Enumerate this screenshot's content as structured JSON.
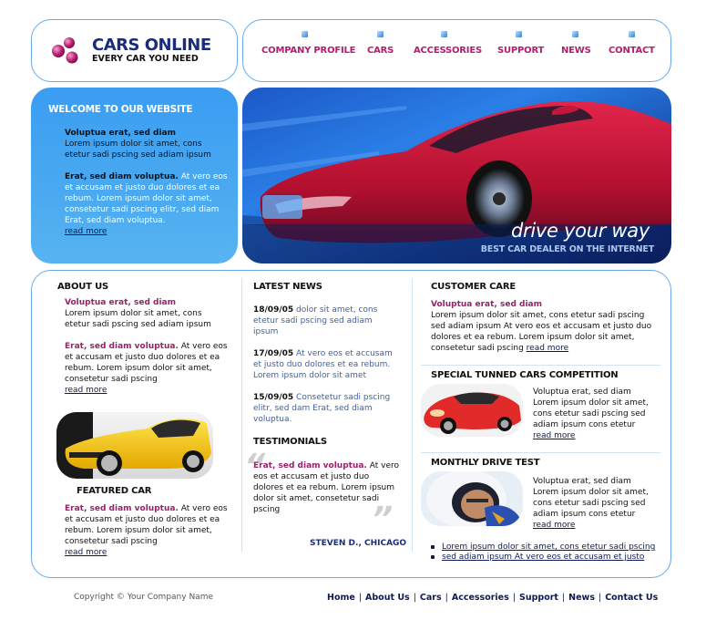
{
  "brand": {
    "title": "CARS ONLINE",
    "subtitle": "EVERY CAR YOU NEED"
  },
  "nav": {
    "items": [
      {
        "label": "COMPANY PROFILE"
      },
      {
        "label": "CARS"
      },
      {
        "label": "ACCESSORIES"
      },
      {
        "label": "SUPPORT"
      },
      {
        "label": "NEWS"
      },
      {
        "label": "CONTACT"
      }
    ]
  },
  "welcome": {
    "title": "WELCOME TO OUR WEBSITE",
    "p1_bold": "Voluptua erat, sed diam",
    "p1_text": "Lorem ipsum dolor sit amet, cons etetur sadi pscing sed adiam ipsum",
    "p2_bold": "Erat, sed diam voluptua.",
    "p2_white": "At vero eos et accusam et justo duo dolores et ea rebum. Lorem ipsum dolor sit amet, consetetur sadi pscing elitr, sed diam Erat, sed diam voluptua.",
    "read_more": "read more"
  },
  "hero": {
    "tagline": "drive your way",
    "subtag": "BEST CAR DEALER ON THE INTERNET"
  },
  "about": {
    "heading": "ABOUT US",
    "p1_title": "Voluptua erat, sed diam",
    "p1_text": "Lorem ipsum dolor sit amet, cons etetur sadi pscing sed adiam ipsum",
    "p2_title": "Erat, sed diam voluptua.",
    "p2_text": "At vero eos et accusam et justo duo dolores et ea rebum. Lorem ipsum dolor sit amet, consetetur sadi pscing",
    "read_more": "read more",
    "featured_heading": "FEATURED CAR",
    "f_title": "Erat, sed diam voluptua.",
    "f_text": "At vero eos et accusam et justo duo dolores et ea rebum. Lorem ipsum dolor sit amet, consetetur sadi pscing",
    "f_read_more": "read more"
  },
  "news": {
    "heading": "LATEST NEWS",
    "items": [
      {
        "date": "18/09/05",
        "text": "dolor sit amet, cons etetur sadi pscing sed adiam ipsum"
      },
      {
        "date": "17/09/05",
        "text": "At vero eos et accusam et justo duo dolores et ea rebum. Lorem ipsum dolor sit amet"
      },
      {
        "date": "15/09/05",
        "text": "Consetetur sadi pscing elitr, sed dam Erat, sed diam voluptua."
      }
    ]
  },
  "testimonials": {
    "heading": "TESTIMONIALS",
    "title": "Erat, sed diam voluptua.",
    "text": "At vero eos et accusam et justo duo dolores et ea rebum. Lorem ipsum dolor sit amet, consetetur sadi pscing",
    "author": "STEVEN D., CHICAGO"
  },
  "care": {
    "heading": "CUSTOMER CARE",
    "title": "Voluptua erat, sed diam",
    "text": "Lorem ipsum dolor sit amet, cons etetur sadi pscing sed adiam ipsum At vero eos et accusam et justo duo dolores et ea rebum. Lorem ipsum dolor sit amet, consetetur sadi pscing",
    "read_more": "read more"
  },
  "competition": {
    "heading": "SPECIAL TUNNED CARS COMPETITION",
    "text": "Voluptua erat, sed diam Lorem ipsum dolor sit amet, cons etetur sadi pscing sed adiam ipsum cons etetur",
    "read_more": "read more"
  },
  "drive_test": {
    "heading": "MONTHLY DRIVE TEST",
    "text": "Voluptua erat, sed diam Lorem ipsum dolor sit amet, cons etetur sadi pscing sed adiam ipsum cons etetur",
    "read_more": "read more",
    "links": [
      "Lorem ipsum dolor sit amet, cons etetur sadi pscing",
      "sed adiam ipsum At vero eos et accusam et justo"
    ]
  },
  "footer": {
    "copyright": "Copyright © Your Company Name",
    "links": [
      "Home",
      "About Us",
      "Cars",
      "Accessories",
      "Support",
      "News",
      "Contact Us"
    ]
  },
  "colors": {
    "accent_pink": "#9b1f6a",
    "nav_pink": "#b01e6c",
    "brand_navy": "#1a2c7a",
    "border_blue": "#6aa9e9",
    "welcome_blue": "#3a9df2"
  }
}
